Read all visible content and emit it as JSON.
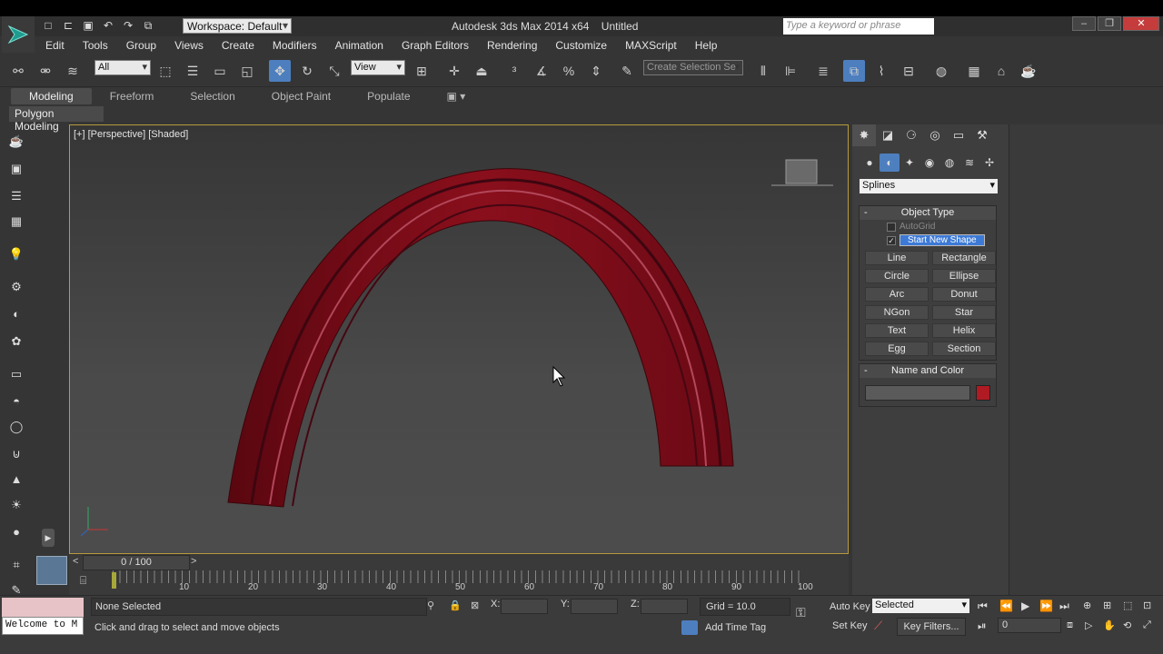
{
  "app": {
    "title": "Autodesk 3ds Max  2014 x64",
    "document": "Untitled"
  },
  "workspace": "Workspace: Default",
  "search": {
    "placeholder": "Type a keyword or phrase"
  },
  "menu": [
    "Edit",
    "Tools",
    "Group",
    "Views",
    "Create",
    "Modifiers",
    "Animation",
    "Graph Editors",
    "Rendering",
    "Customize",
    "MAXScript",
    "Help"
  ],
  "toolbar": {
    "filter": "All",
    "refcoord": "View",
    "selection_set_placeholder": "Create Selection Se"
  },
  "ribbon": {
    "tabs": [
      "Modeling",
      "Freeform",
      "Selection",
      "Object Paint",
      "Populate"
    ],
    "active": "Modeling",
    "panel_label": "Polygon Modeling"
  },
  "viewport": {
    "label": "[+] [Perspective] [Shaded]"
  },
  "create_panel": {
    "category": "Splines",
    "object_type_title": "Object Type",
    "autogrid": "AutoGrid",
    "start_new_shape": "Start New Shape",
    "buttons": [
      "Line",
      "Rectangle",
      "Circle",
      "Ellipse",
      "Arc",
      "Donut",
      "NGon",
      "Star",
      "Text",
      "Helix",
      "Egg",
      "Section"
    ],
    "name_color_title": "Name and Color",
    "color": "#b01a22"
  },
  "timeline": {
    "frame": "0 / 100",
    "ticks": [
      "10",
      "20",
      "30",
      "40",
      "50",
      "60",
      "70",
      "80",
      "90",
      "100"
    ]
  },
  "status": {
    "welcome": "Welcome to M",
    "selection": "None Selected",
    "prompt": "Click and drag to select and move objects",
    "x_label": "X:",
    "y_label": "Y:",
    "z_label": "Z:",
    "grid": "Grid = 10.0",
    "add_time_tag": "Add Time Tag",
    "auto_key": "Auto Key",
    "set_key": "Set Key",
    "key_mode": "Selected",
    "key_filters": "Key Filters...",
    "current_frame": "0"
  },
  "colors": {
    "accent": "#4d7fbf",
    "object": "#8a0f1c",
    "viewport_border": "#b89b3c"
  }
}
